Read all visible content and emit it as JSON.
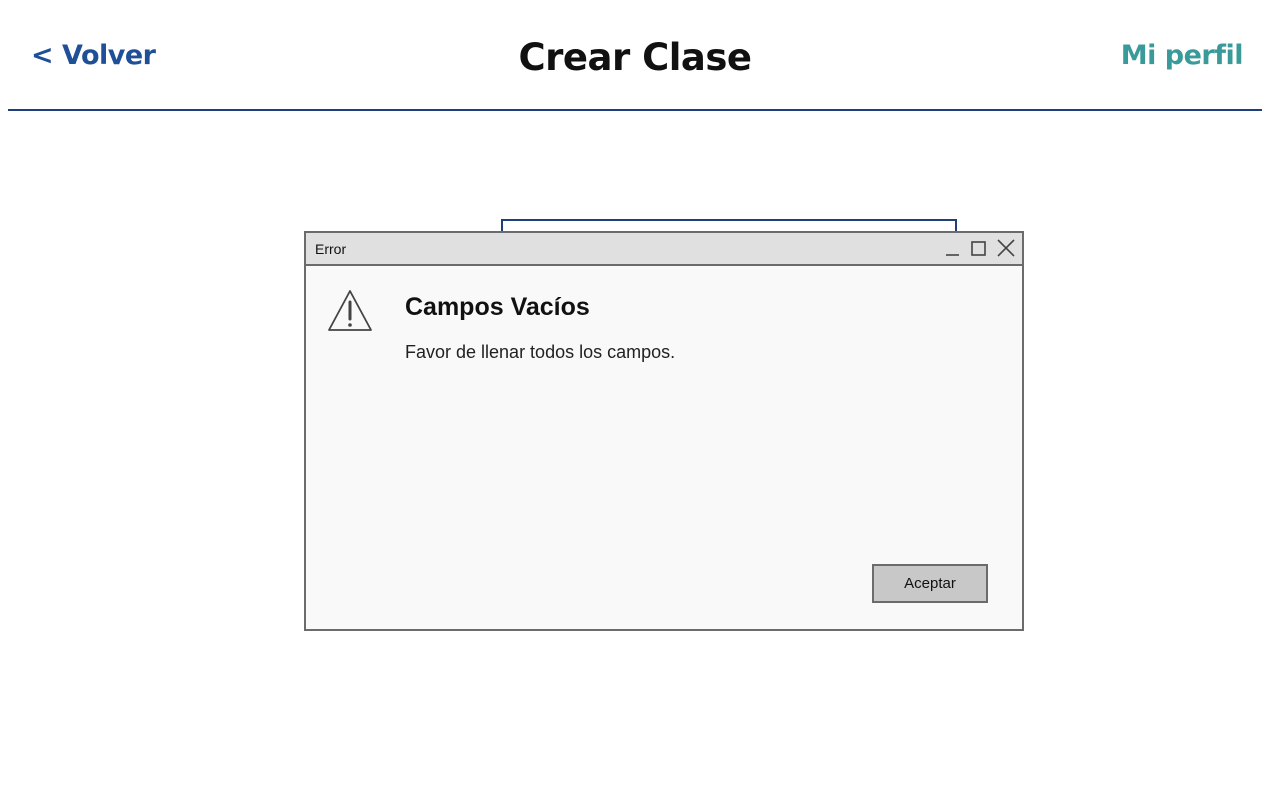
{
  "header": {
    "back_label": "< Volver",
    "title": "Crear Clase",
    "profile_label": "Mi perfil"
  },
  "dialog": {
    "window_title": "Error",
    "heading": "Campos Vacíos",
    "message": "Favor de llenar todos los campos.",
    "accept_label": "Aceptar",
    "icon": "warning-triangle-icon"
  },
  "colors": {
    "back_link": "#1f4f96",
    "profile_link": "#3a9a9a",
    "divider": "#1f3f7a",
    "dialog_border": "#6b6b6b",
    "dialog_titlebar": "#e0e0e0",
    "dialog_body": "#f9f9f9",
    "button_bg": "#c8c8c8"
  }
}
